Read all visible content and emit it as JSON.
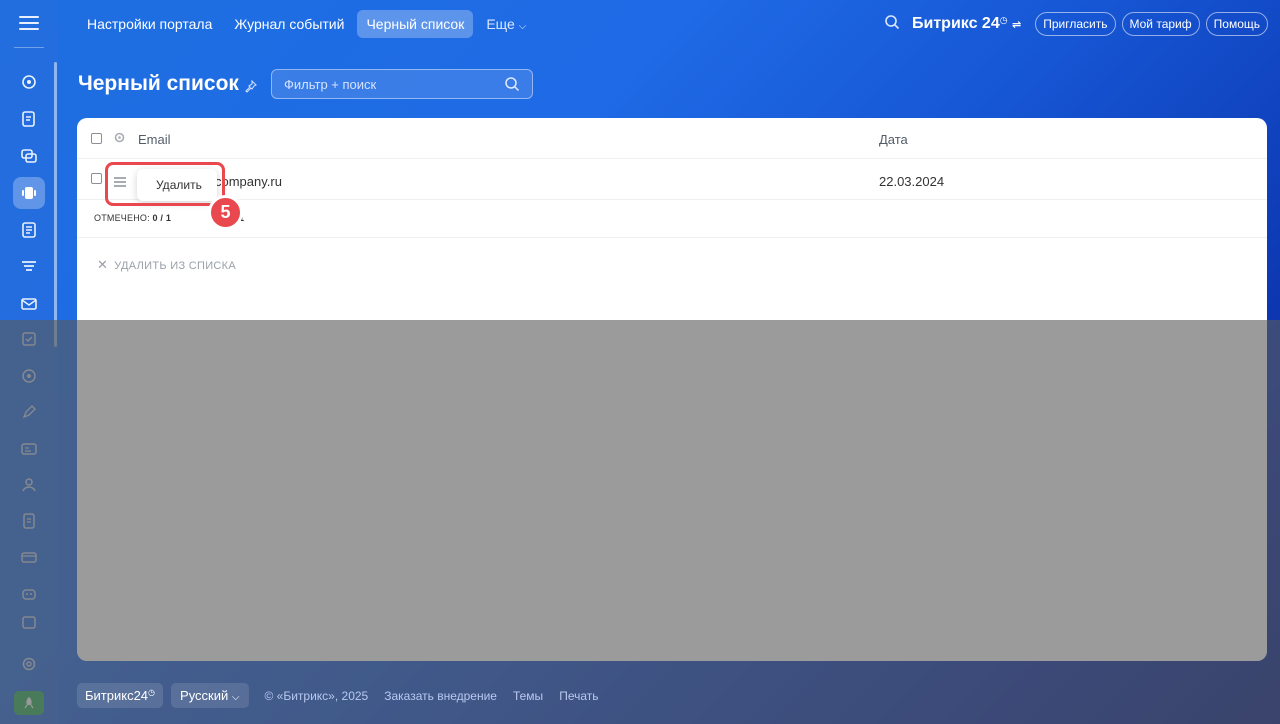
{
  "topnav": {
    "tabs": [
      {
        "label": "Настройки портала"
      },
      {
        "label": "Журнал событий"
      },
      {
        "label": "Черный список"
      },
      {
        "label": "Еще"
      }
    ],
    "logo": "Битрикс 24",
    "invite_label": "Пригласить",
    "tariff_label": "Мой тариф",
    "help_label": "Помощь"
  },
  "page": {
    "title": "Черный список",
    "search_placeholder": "Фильтр + поиск"
  },
  "table": {
    "columns": {
      "email": "Email",
      "date": "Дата"
    },
    "rows": [
      {
        "email": "company.ru",
        "date": "22.03.2024"
      }
    ],
    "marked_label": "ОТМЕЧЕНО:",
    "marked_value": "0 / 1",
    "total_label": "О:",
    "total_value": "1",
    "remove_action": "УДАЛИТЬ ИЗ СПИСКА"
  },
  "context_menu": {
    "delete_label": "Удалить"
  },
  "step_badge": "5",
  "footer": {
    "brand": "Битрикс24",
    "language": "Русский",
    "copyright": "© «Битрикс», 2025",
    "order_link": "Заказать внедрение",
    "themes_link": "Темы",
    "print_link": "Печать"
  },
  "colors": {
    "accent_red": "#e8484e",
    "rocket_green": "#2fb05a"
  }
}
